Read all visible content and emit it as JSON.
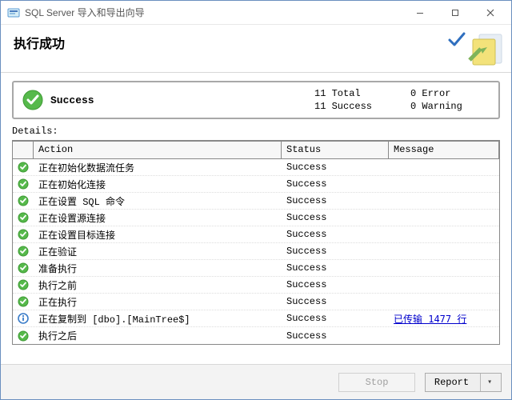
{
  "window": {
    "title": "SQL Server 导入和导出向导"
  },
  "header": {
    "heading": "执行成功"
  },
  "summary": {
    "label": "Success",
    "total_label": "11 Total",
    "success_label": "11 Success",
    "error_label": "0 Error",
    "warning_label": "0 Warning"
  },
  "details_label": "Details:",
  "columns": {
    "icon": "",
    "action": "Action",
    "status": "Status",
    "message": "Message"
  },
  "rows": [
    {
      "icon": "success",
      "action": "正在初始化数据流任务",
      "status": "Success",
      "message": ""
    },
    {
      "icon": "success",
      "action": "正在初始化连接",
      "status": "Success",
      "message": ""
    },
    {
      "icon": "success",
      "action": "正在设置 SQL 命令",
      "status": "Success",
      "message": ""
    },
    {
      "icon": "success",
      "action": "正在设置源连接",
      "status": "Success",
      "message": ""
    },
    {
      "icon": "success",
      "action": "正在设置目标连接",
      "status": "Success",
      "message": ""
    },
    {
      "icon": "success",
      "action": "正在验证",
      "status": "Success",
      "message": ""
    },
    {
      "icon": "success",
      "action": "准备执行",
      "status": "Success",
      "message": ""
    },
    {
      "icon": "success",
      "action": "执行之前",
      "status": "Success",
      "message": ""
    },
    {
      "icon": "success",
      "action": "正在执行",
      "status": "Success",
      "message": ""
    },
    {
      "icon": "info",
      "action": "正在复制到 [dbo].[MainTree$]",
      "status": "Success",
      "message": "已传输 1477 行"
    },
    {
      "icon": "success",
      "action": "执行之后",
      "status": "Success",
      "message": ""
    }
  ],
  "footer": {
    "stop": "Stop",
    "report": "Report"
  }
}
